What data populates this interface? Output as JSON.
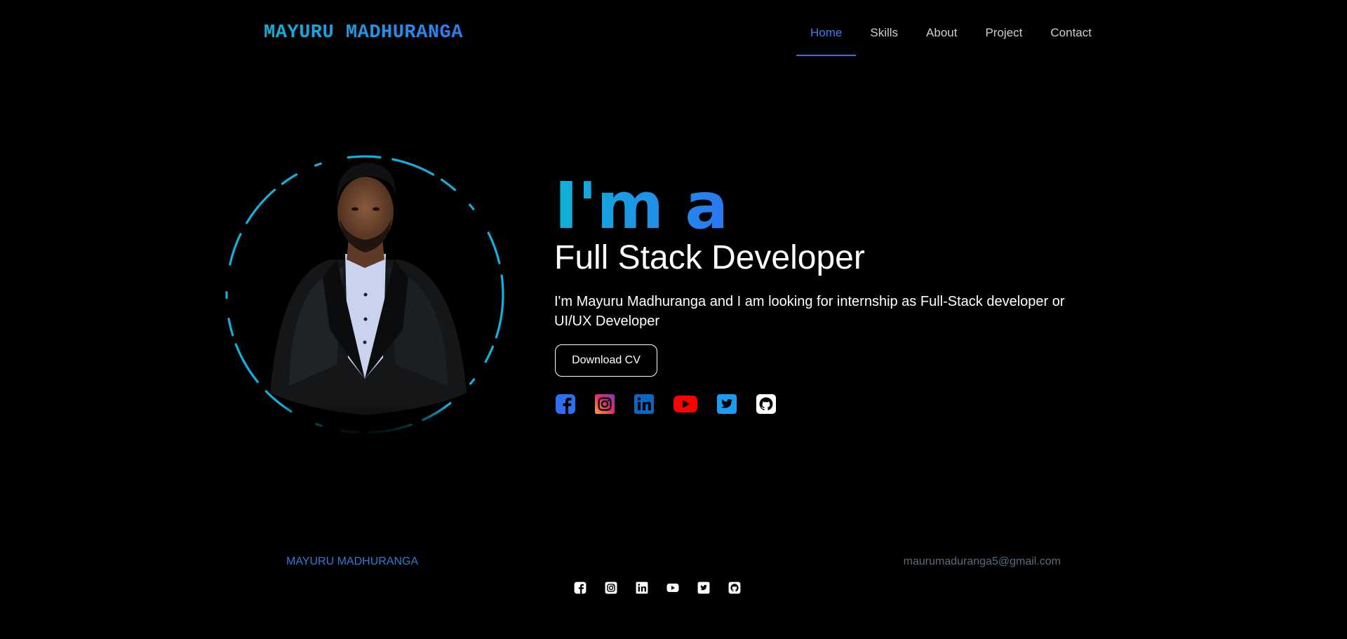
{
  "header": {
    "logo": "MAYURU MADHURANGA",
    "nav": [
      {
        "label": "Home",
        "active": true
      },
      {
        "label": "Skills",
        "active": false
      },
      {
        "label": "About",
        "active": false
      },
      {
        "label": "Project",
        "active": false
      },
      {
        "label": "Contact",
        "active": false
      }
    ]
  },
  "hero": {
    "greeting": "I'm a",
    "role": "Full Stack Developer",
    "description": "I'm Mayuru Madhuranga and I am looking for internship as Full-Stack developer or UI/UX Developer",
    "cv_button": "Download CV",
    "socials": [
      {
        "icon": "facebook-icon",
        "color": "#2f6ef0"
      },
      {
        "icon": "instagram-icon",
        "color": "#e1306c"
      },
      {
        "icon": "linkedin-icon",
        "color": "#0a66c2"
      },
      {
        "icon": "youtube-icon",
        "color": "#ff0000"
      },
      {
        "icon": "twitter-icon",
        "color": "#1d9bf0"
      },
      {
        "icon": "github-icon",
        "color": "#ffffff"
      }
    ]
  },
  "footer": {
    "name": "MAYURU MADHURANGA",
    "email": "maurumaduranga5@gmail.com",
    "icons": [
      "facebook-icon",
      "instagram-icon",
      "linkedin-icon",
      "youtube-icon",
      "twitter-icon",
      "github-icon"
    ]
  },
  "colors": {
    "background": "#000000",
    "accent_cyan": "#0fb2d8",
    "accent_blue": "#2f7bf2"
  }
}
